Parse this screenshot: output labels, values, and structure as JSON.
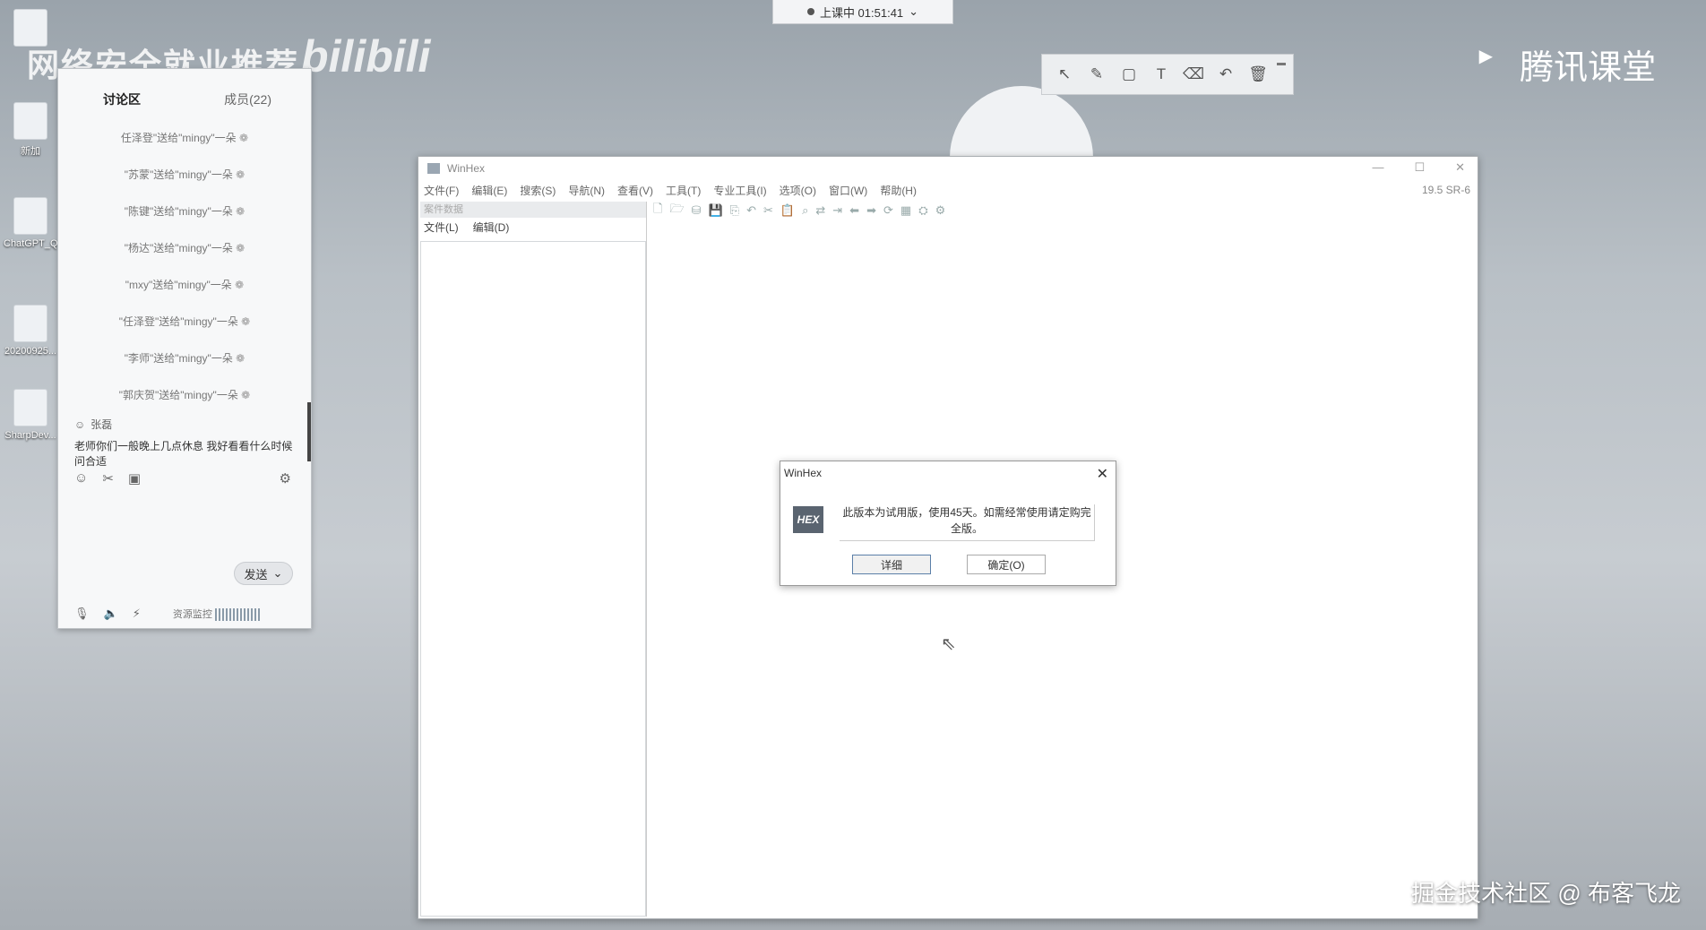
{
  "timer": {
    "label": "上课中 01:51:41",
    "caret": "⌄"
  },
  "watermarks": {
    "top_left": "网络安全就业推荐",
    "bilibili": "bilibili",
    "tencent": "腾讯课堂",
    "bottom_right": "掘金技术社区 @ 布客飞龙"
  },
  "desktop_icons": [
    {
      "label": "新加"
    },
    {
      "label": "ChatGPT_Q..."
    },
    {
      "label": "20200925..."
    },
    {
      "label": "SharpDev..."
    }
  ],
  "chat": {
    "tab_discussion": "讨论区",
    "tab_members": "成员(22)",
    "gifts": [
      "任泽登\"送给\"mingy\"一朵",
      "\"苏蒙\"送给\"mingy\"一朵",
      "\"陈键\"送给\"mingy\"一朵",
      "\"杨达\"送给\"mingy\"一朵",
      "\"mxy\"送给\"mingy\"一朵",
      "\"任泽登\"送给\"mingy\"一朵",
      "\"李师\"送给\"mingy\"一朵",
      "\"郭庆贺\"送给\"mingy\"一朵"
    ],
    "message": {
      "author": "张磊",
      "text": "老师你们一般晚上几点休息  我好看看什么时候问合适"
    },
    "send_label": "发送",
    "resource_label": "资源监控"
  },
  "winhex": {
    "title": "WinHex",
    "version": "19.5 SR-6",
    "menu": [
      "文件(F)",
      "编辑(E)",
      "搜索(S)",
      "导航(N)",
      "查看(V)",
      "工具(T)",
      "专业工具(I)",
      "选项(O)",
      "窗口(W)",
      "帮助(H)"
    ],
    "left_pane": {
      "header": "案件数据",
      "menu": [
        "文件(L)",
        "编辑(D)"
      ]
    }
  },
  "dialog": {
    "title": "WinHex",
    "logo": "HEX",
    "message": "此版本为试用版，使用45天。如需经常使用请定购完全版。",
    "details_label": "详细",
    "ok_label": "确定(O)"
  }
}
